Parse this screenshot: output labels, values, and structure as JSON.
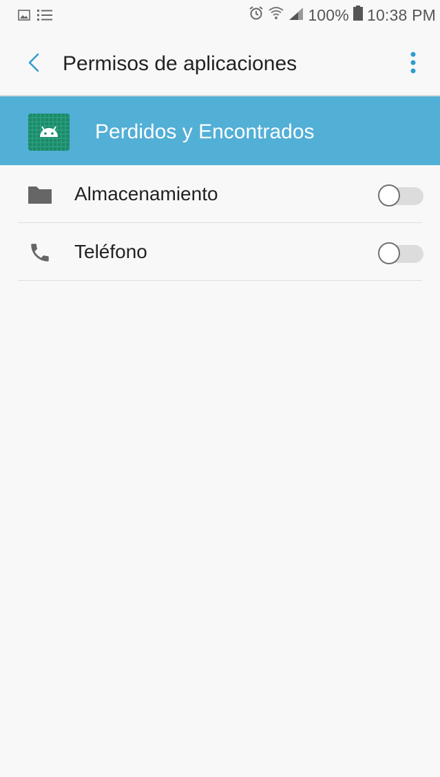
{
  "status_bar": {
    "battery": "100%",
    "time": "10:38 PM",
    "icons_left": [
      "gallery-notification-icon",
      "list-notification-icon"
    ],
    "icons_right": [
      "alarm-icon",
      "wifi-icon",
      "signal-icon",
      "battery-icon"
    ]
  },
  "header": {
    "title": "Permisos de aplicaciones",
    "back_icon": "chevron-left-icon",
    "more_icon": "more-vert-icon",
    "accent_color": "#2f9bd0"
  },
  "app": {
    "name": "Perdidos y Encontrados",
    "icon": "android-app-icon",
    "banner_color": "#52afd6",
    "icon_color": "#1c8a6a"
  },
  "permissions": [
    {
      "label": "Almacenamiento",
      "icon": "folder-icon",
      "enabled": false
    },
    {
      "label": "Teléfono",
      "icon": "phone-icon",
      "enabled": false
    }
  ]
}
